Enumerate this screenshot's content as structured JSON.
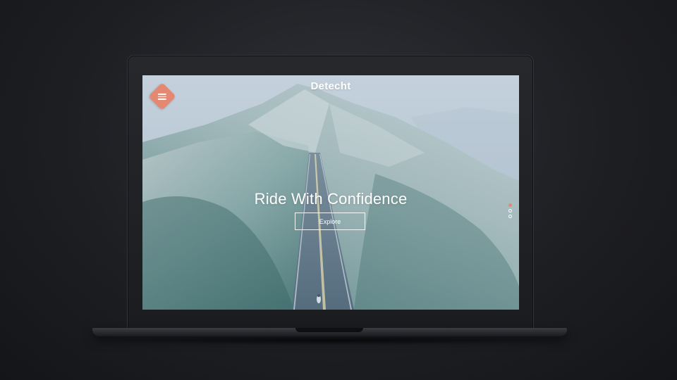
{
  "site": {
    "logo_text": "Detecht"
  },
  "menu": {
    "icon": "hamburger-menu-icon"
  },
  "hero": {
    "title": "Ride With Confidence",
    "cta_label": "Explore"
  },
  "pager": {
    "count": 3,
    "active_index": 0
  },
  "colors": {
    "accent": "#e58871",
    "text": "#ffffff"
  }
}
